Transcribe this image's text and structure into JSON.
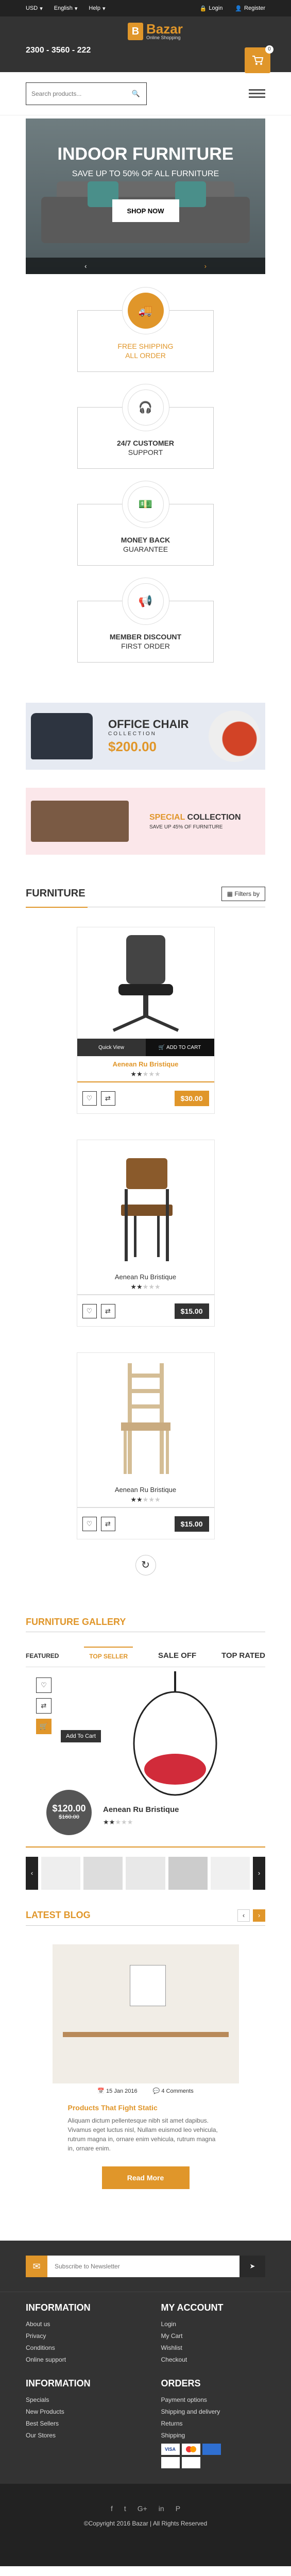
{
  "topbar": {
    "currency": "USD",
    "language": "English",
    "help": "Help",
    "login": "Login",
    "register": "Register"
  },
  "header": {
    "phone": "2300 - 3560 - 222",
    "logo_title": "Bazar",
    "logo_sub": "Online Shopping",
    "cart_count": "0"
  },
  "search": {
    "placeholder": "Search products..."
  },
  "hero": {
    "title": "INDOOR FURNITURE",
    "subtitle": "SAVE UP TO 50% OF ALL FURNITURE",
    "button": "SHOP NOW"
  },
  "features": [
    {
      "line1": "FREE SHIPPING",
      "line2": "ALL ORDER"
    },
    {
      "line1": "24/7 CUSTOMER",
      "line2": "SUPPORT"
    },
    {
      "line1": "MONEY BACK",
      "line2": "GUARANTEE"
    },
    {
      "line1": "MEMBER DISCOUNT",
      "line2": "FIRST ORDER"
    }
  ],
  "banner1": {
    "title": "OFFICE CHAIR",
    "sub": "COLLECTION",
    "price": "$200.00"
  },
  "banner2": {
    "title_accent": "SPECIAL",
    "title_rest": "COLLECTION",
    "sub": "SAVE UP 45% OF FURNITURE"
  },
  "furniture": {
    "title": "FURNITURE",
    "filter": "Filters by"
  },
  "products": [
    {
      "name": "Aenean Ru Bristique",
      "price": "$30.00",
      "quick": "Quick View",
      "add": "ADD TO CART"
    },
    {
      "name": "Aenean Ru Bristique",
      "price": "$15.00"
    },
    {
      "name": "Aenean Ru Bristique",
      "price": "$15.00"
    }
  ],
  "gallery": {
    "title": "FURNITURE GALLERY",
    "tabs": [
      "FEATURED",
      "TOP SELLER",
      "SALE OFF",
      "TOP RATED"
    ],
    "add_to_cart": "Add To Cart",
    "price": "$120.00",
    "old_price": "$160.00",
    "product": "Aenean Ru Bristique"
  },
  "blog": {
    "title": "LATEST BLOG",
    "date": "15 Jan 2016",
    "comments": "4 Comments",
    "post_title": "Products That Fight Static",
    "text": "Aliquam dictum pellentesque nibh sit amet dapibus. Vivamus eget luctus nisl, Nullam euismod leo vehicula, rutrum magna in, ornare enim vehicula, rutrum magna in, ornare enim.",
    "button": "Read More"
  },
  "newsletter": {
    "placeholder": "Subscribe to Newsletter"
  },
  "footer": {
    "information": {
      "title": "INFORMATION",
      "items": [
        "About us",
        "Privacy",
        "Conditions",
        "Online support"
      ]
    },
    "account": {
      "title": "MY ACCOUNT",
      "items": [
        "Login",
        "My Cart",
        "Wishlist",
        "Checkout"
      ]
    },
    "information2": {
      "title": "INFORMATION",
      "items": [
        "Specials",
        "New Products",
        "Best Sellers",
        "Our Stores"
      ]
    },
    "orders": {
      "title": "ORDERS",
      "items": [
        "Payment options",
        "Shipping and delivery",
        "Returns",
        "Shipping"
      ]
    },
    "copyright": "©Copyright 2016 Bazar | All Rights Reserved"
  },
  "colors": {
    "accent": "#e0962a",
    "dark": "#333333"
  }
}
